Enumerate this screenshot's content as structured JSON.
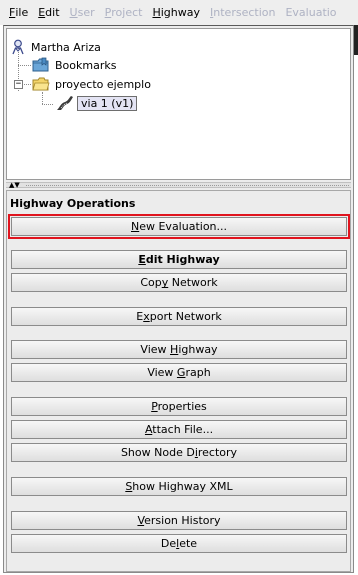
{
  "menu": [
    {
      "before": "",
      "mnemonic": "F",
      "after": "ile",
      "enabled": true
    },
    {
      "before": "",
      "mnemonic": "E",
      "after": "dit",
      "enabled": true
    },
    {
      "before": "",
      "mnemonic": "U",
      "after": "ser",
      "enabled": false
    },
    {
      "before": "",
      "mnemonic": "P",
      "after": "roject",
      "enabled": false
    },
    {
      "before": "",
      "mnemonic": "H",
      "after": "ighway",
      "enabled": true
    },
    {
      "before": "",
      "mnemonic": "I",
      "after": "ntersection",
      "enabled": false
    },
    {
      "before": "",
      "mnemonic": "",
      "after": "Evaluatio",
      "enabled": false
    }
  ],
  "tree": {
    "user": "Martha Ariza",
    "bookmarks": "Bookmarks",
    "project": "proyecto ejemplo",
    "expander": "−",
    "highway": "via 1 (v1)"
  },
  "operations": {
    "title": "Highway Operations",
    "buttons": [
      {
        "id": "new-evaluation",
        "before": "",
        "mnemonic": "N",
        "after": "ew Evaluation...",
        "bold": false,
        "highlighted": true
      },
      {
        "id": "edit-highway",
        "before": "",
        "mnemonic": "E",
        "after": "dit Highway",
        "bold": true,
        "highlighted": false
      },
      {
        "id": "copy-network",
        "before": "Cop",
        "mnemonic": "y",
        "after": " Network",
        "bold": false,
        "highlighted": false
      },
      {
        "id": "export-network",
        "before": "E",
        "mnemonic": "x",
        "after": "port Network",
        "bold": false,
        "highlighted": false
      },
      {
        "id": "view-highway",
        "before": "View ",
        "mnemonic": "H",
        "after": "ighway",
        "bold": false,
        "highlighted": false
      },
      {
        "id": "view-graph",
        "before": "View ",
        "mnemonic": "G",
        "after": "raph",
        "bold": false,
        "highlighted": false
      },
      {
        "id": "properties",
        "before": "",
        "mnemonic": "P",
        "after": "roperties",
        "bold": false,
        "highlighted": false
      },
      {
        "id": "attach-file",
        "before": "",
        "mnemonic": "A",
        "after": "ttach File...",
        "bold": false,
        "highlighted": false
      },
      {
        "id": "show-node-directory",
        "before": "Show Node D",
        "mnemonic": "i",
        "after": "rectory",
        "bold": false,
        "highlighted": false
      },
      {
        "id": "show-highway-xml",
        "before": "",
        "mnemonic": "S",
        "after": "how Highway XML",
        "bold": false,
        "highlighted": false
      },
      {
        "id": "version-history",
        "before": "",
        "mnemonic": "V",
        "after": "ersion History",
        "bold": false,
        "highlighted": false
      },
      {
        "id": "delete",
        "before": "De",
        "mnemonic": "l",
        "after": "ete",
        "bold": false,
        "highlighted": false
      }
    ]
  },
  "colors": {
    "highlight_border": "#e0141e",
    "disabled_menu": "#aeb2c3",
    "panel_bg": "#ececec"
  },
  "icons": {
    "user": "user-icon",
    "bookmarks": "bookmarks-folder-icon",
    "project": "project-folder-icon",
    "highway": "highway-road-icon",
    "splitter": "split-arrows-icon"
  }
}
